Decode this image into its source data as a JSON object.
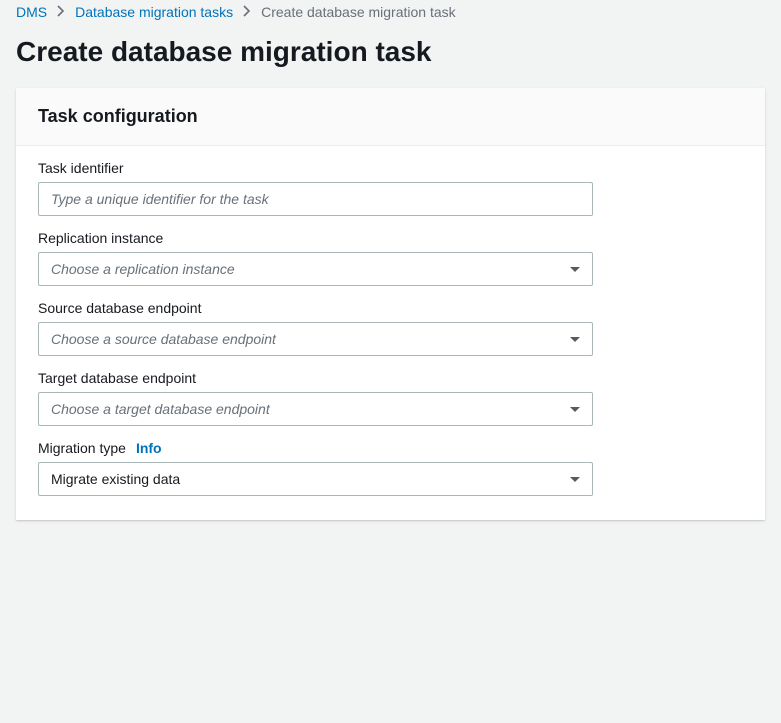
{
  "breadcrumb": {
    "items": [
      {
        "label": "DMS"
      },
      {
        "label": "Database migration tasks"
      }
    ],
    "current": "Create database migration task"
  },
  "page_title": "Create database migration task",
  "panel": {
    "header": "Task configuration",
    "fields": {
      "task_identifier": {
        "label": "Task identifier",
        "placeholder": "Type a unique identifier for the task",
        "value": ""
      },
      "replication_instance": {
        "label": "Replication instance",
        "placeholder": "Choose a replication instance",
        "value": ""
      },
      "source_endpoint": {
        "label": "Source database endpoint",
        "placeholder": "Choose a source database endpoint",
        "value": ""
      },
      "target_endpoint": {
        "label": "Target database endpoint",
        "placeholder": "Choose a target database endpoint",
        "value": ""
      },
      "migration_type": {
        "label": "Migration type",
        "info": "Info",
        "value": "Migrate existing data"
      }
    }
  }
}
